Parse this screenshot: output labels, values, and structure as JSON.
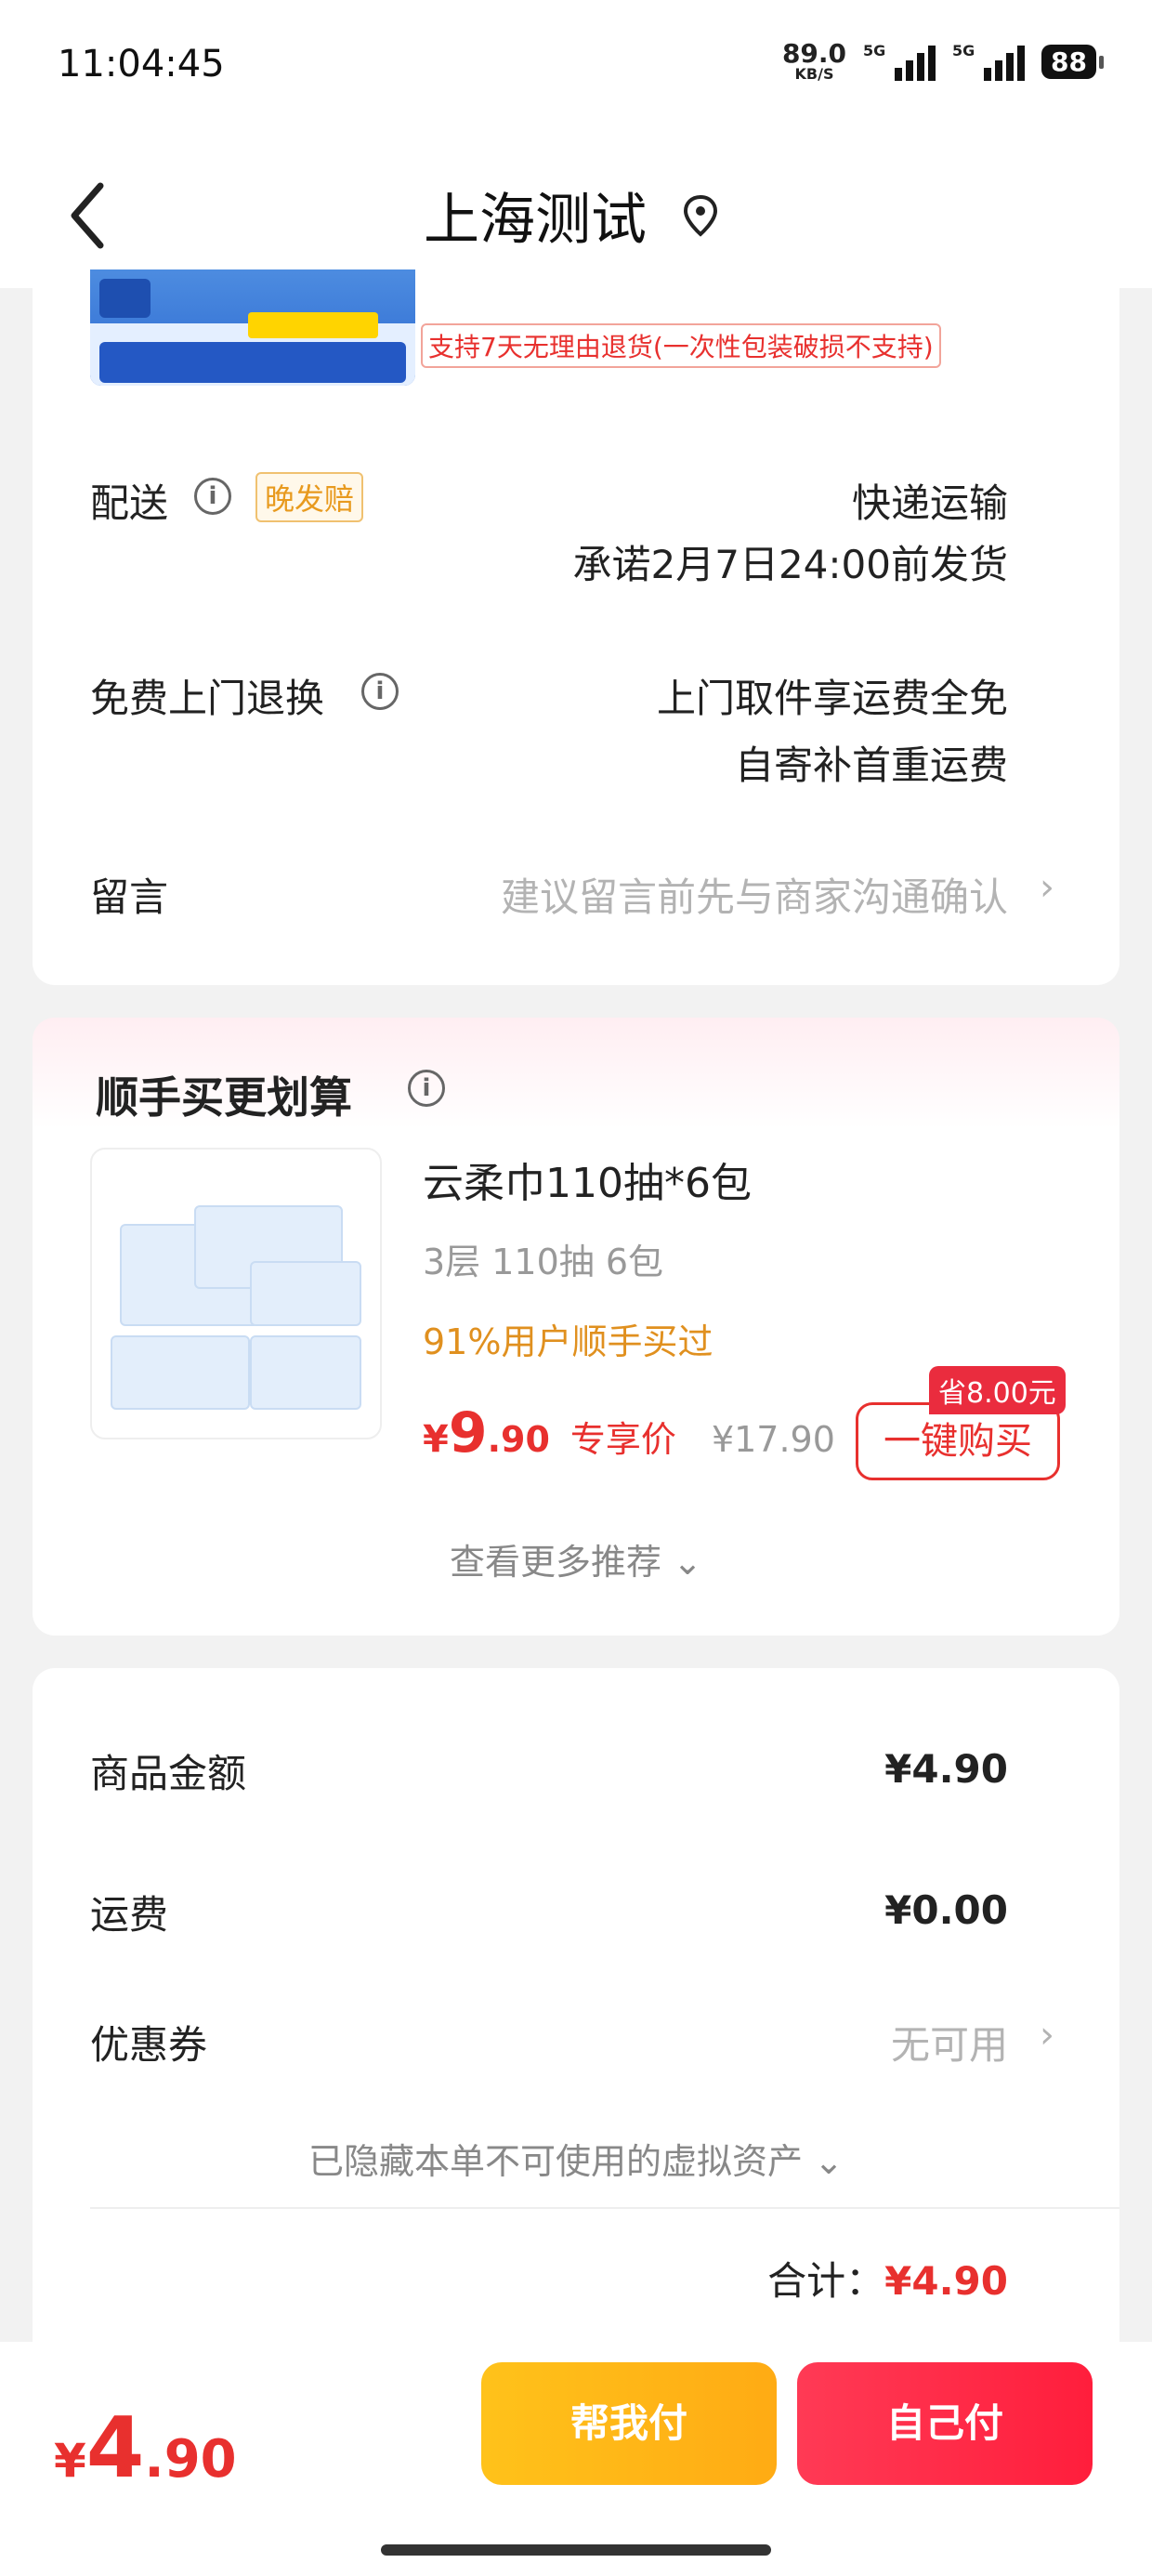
{
  "status_bar": {
    "time": "11:04:45",
    "speed_value": "89.0",
    "speed_unit": "KB/S",
    "sim1_label": "5G",
    "sim2_label": "5G",
    "battery": "88"
  },
  "nav": {
    "title": "上海测试",
    "back_icon": "chevron-left-icon",
    "location_icon": "location-pin-icon"
  },
  "order_info": {
    "return_policy": "支持7天无理由退货(一次性包装破损不支持)",
    "delivery": {
      "label": "配送",
      "badge": "晚发赔",
      "method": "快递运输",
      "promise": "承诺2月7日24:00前发货"
    },
    "free_return": {
      "label": "免费上门退换",
      "line1": "上门取件享运费全免",
      "line2": "自寄补首重运费"
    },
    "message": {
      "label": "留言",
      "placeholder": "建议留言前先与商家沟通确认"
    }
  },
  "recommend": {
    "title": "顺手买更划算",
    "product": {
      "name": "云柔巾110抽*6包",
      "spec": "3层 110抽 6包",
      "stat": "91%用户顺手买过",
      "price_symbol": "¥",
      "price_int": "9",
      "price_dec": ".90",
      "price_label": "专享价",
      "original_price": "¥17.90",
      "save_badge": "省8.00元",
      "buy_label": "一键购买"
    },
    "more_label": "查看更多推荐"
  },
  "summary": {
    "goods_label": "商品金额",
    "goods_value": "¥4.90",
    "shipping_label": "运费",
    "shipping_value": "¥0.00",
    "coupon_label": "优惠券",
    "coupon_value": "无可用",
    "hidden_assets": "已隐藏本单不可使用的虚拟资产",
    "total_label": "合计：",
    "total_value": "¥4.90"
  },
  "bottom_bar": {
    "price_symbol": "¥",
    "price_int": "4",
    "price_dec": ".90",
    "help_pay": "帮我付",
    "self_pay": "自己付"
  },
  "colors": {
    "accent_red": "#e8302e",
    "help_button": "#ffb816",
    "self_button": "#ff2a48",
    "late_badge": "#e89a1e"
  }
}
